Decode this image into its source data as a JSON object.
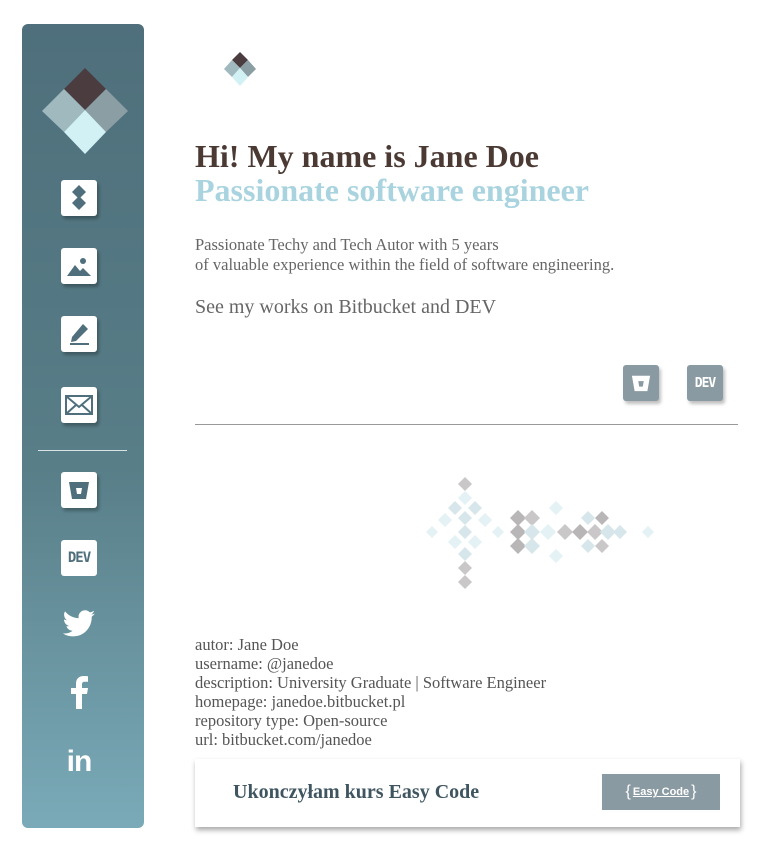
{
  "sidebar": {
    "items": [
      {
        "name": "home-icon"
      },
      {
        "name": "image-icon"
      },
      {
        "name": "edit-icon"
      },
      {
        "name": "mail-icon"
      }
    ],
    "social": [
      {
        "name": "bitbucket-icon"
      },
      {
        "name": "dev-icon",
        "label": "DEV"
      },
      {
        "name": "twitter-icon"
      },
      {
        "name": "facebook-icon"
      },
      {
        "name": "linkedin-icon",
        "label": "in"
      }
    ]
  },
  "hero": {
    "title": "Hi! My name is Jane Doe",
    "subtitle": "Passionate software engineer",
    "intro_line1": "Passionate Techy and Tech Autor with 5 years",
    "intro_line2": "of valuable experience within the field of software engineering.",
    "works": "See my works on Bitbucket and DEV"
  },
  "links": {
    "dev_label": "DEV"
  },
  "profile": {
    "autor": "autor: Jane Doe",
    "username": "username: @janedoe",
    "description": "description: University Graduate | Software Engineer",
    "homepage": "homepage: janedoe.bitbucket.pl",
    "repository_type": "repository type: Open-source",
    "url": "url: bitbucket.com/janedoe"
  },
  "course": {
    "text": "Ukonczyłam kurs Easy Code",
    "badge_left": "{",
    "badge_label": "Easy Code",
    "badge_right": "}"
  },
  "colors": {
    "sidebar_top": "#4e6f7b",
    "sidebar_bottom": "#7aaab8",
    "title": "#4b3a33",
    "subtitle": "#a9d4df",
    "button_gray": "#8a9aa2"
  }
}
